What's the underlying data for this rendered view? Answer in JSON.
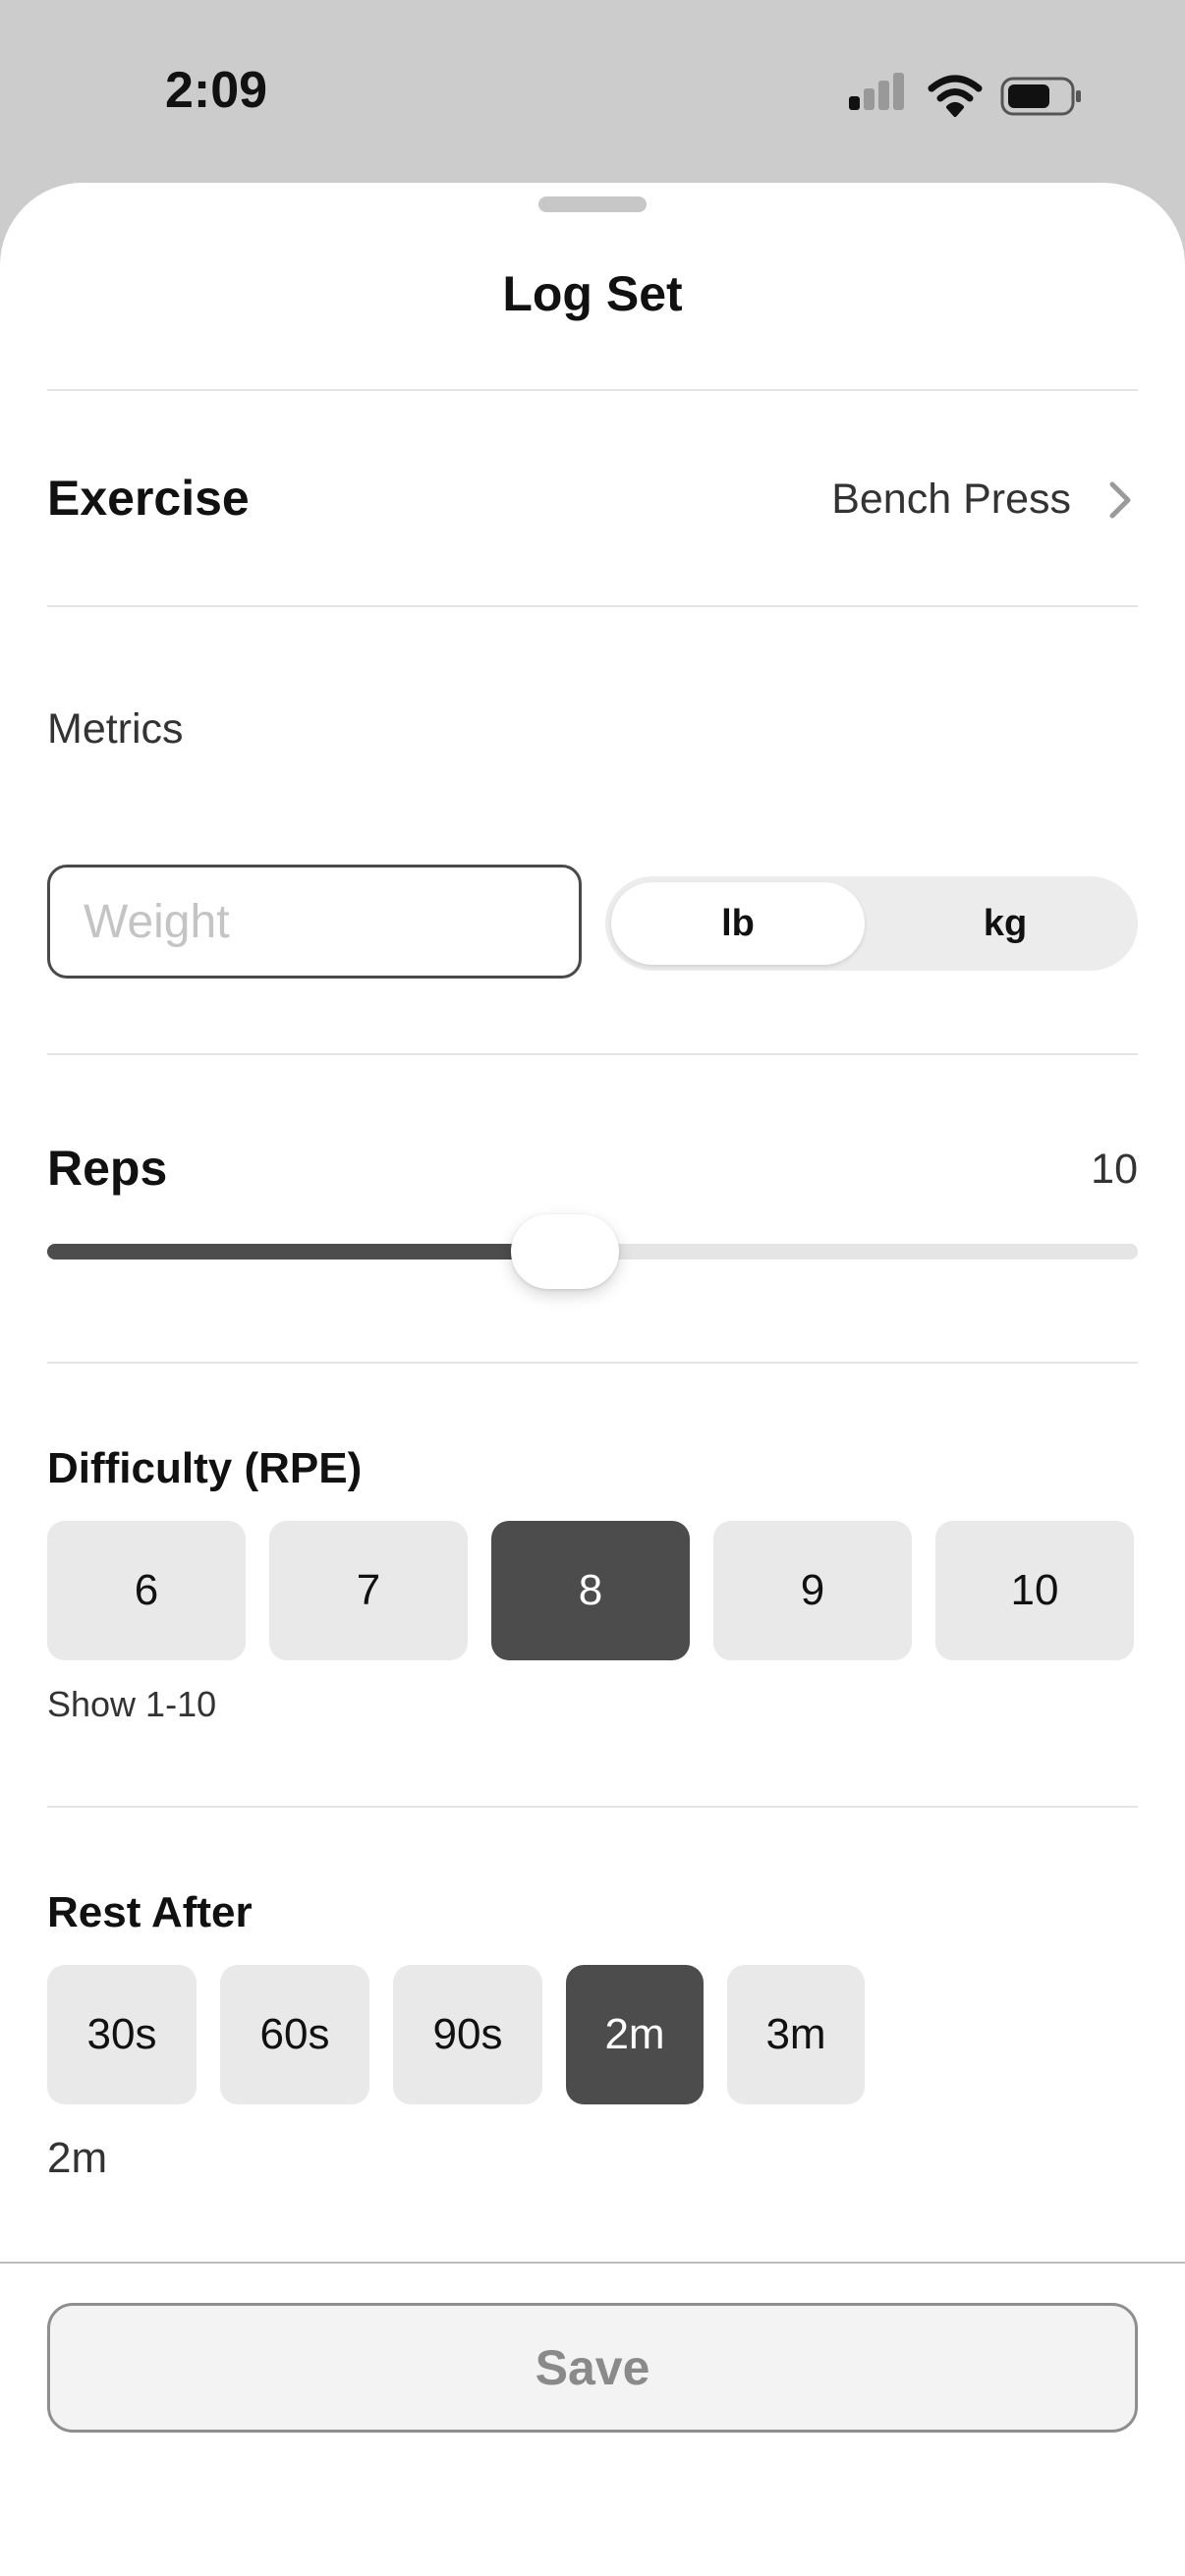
{
  "status_bar": {
    "time": "2:09"
  },
  "sheet": {
    "title": "Log Set"
  },
  "exercise": {
    "label": "Exercise",
    "value": "Bench Press"
  },
  "metrics": {
    "section_label": "Metrics",
    "weight_placeholder": "Weight",
    "weight_value": "",
    "units": [
      {
        "label": "lb",
        "selected": true
      },
      {
        "label": "kg",
        "selected": false
      }
    ]
  },
  "reps": {
    "label": "Reps",
    "value": "10",
    "slider_fraction": 0.475
  },
  "difficulty": {
    "label": "Difficulty (RPE)",
    "options": [
      {
        "label": "6",
        "selected": false
      },
      {
        "label": "7",
        "selected": false
      },
      {
        "label": "8",
        "selected": true
      },
      {
        "label": "9",
        "selected": false
      },
      {
        "label": "10",
        "selected": false
      }
    ],
    "show_all_label": "Show 1-10"
  },
  "rest": {
    "label": "Rest After",
    "options": [
      {
        "label": "30s",
        "selected": false
      },
      {
        "label": "60s",
        "selected": false
      },
      {
        "label": "90s",
        "selected": false
      },
      {
        "label": "2m",
        "selected": true
      },
      {
        "label": "3m",
        "selected": false
      }
    ],
    "summary": "2m"
  },
  "footer": {
    "save_label": "Save"
  },
  "colors": {
    "accent_selected": "#4c4c4c",
    "chip_background": "#e9e9e9",
    "status_bar_background": "#cccccc"
  }
}
